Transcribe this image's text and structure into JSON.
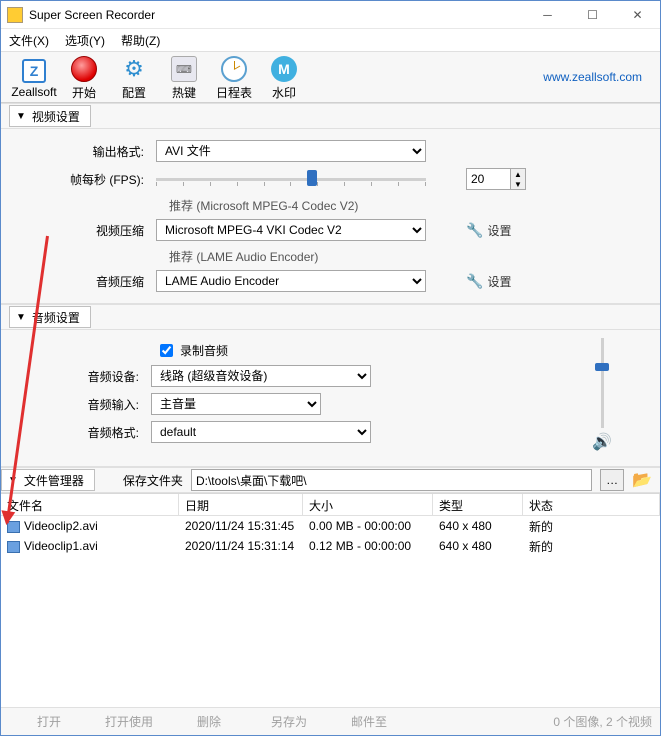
{
  "titlebar": {
    "title": "Super Screen Recorder"
  },
  "menus": {
    "file": "文件(X)",
    "options": "选项(Y)",
    "help": "帮助(Z)"
  },
  "toolbar": {
    "brand": "Zeallsoft",
    "start": "开始",
    "config": "配置",
    "hotkey": "热键",
    "schedule": "日程表",
    "watermark": "水印",
    "url": "www.zeallsoft.com"
  },
  "sections": {
    "video": "视频设置",
    "audio": "音频设置",
    "files": "文件管理器"
  },
  "video": {
    "output_label": "输出格式:",
    "output_value": "AVI 文件",
    "fps_label": "帧每秒 (FPS):",
    "fps_value": "20",
    "vcodec_rec": "推荐 (Microsoft MPEG-4 Codec V2)",
    "vcodec_label": "视频压缩",
    "vcodec_value": "Microsoft MPEG-4  VKI  Codec V2",
    "acodec_rec": "推荐 (LAME Audio Encoder)",
    "acodec_label": "音频压缩",
    "acodec_value": "LAME Audio Encoder",
    "settings": "设置"
  },
  "audio": {
    "record_label": "录制音频",
    "device_label": "音频设备:",
    "device_value": "线路 (超级音效设备)",
    "input_label": "音频输入:",
    "input_value": "主音量",
    "format_label": "音频格式:",
    "format_value": "default"
  },
  "filemgr": {
    "save_label": "保存文件夹",
    "save_path": "D:\\tools\\桌面\\下载吧\\"
  },
  "table": {
    "headers": {
      "name": "文件名",
      "date": "日期",
      "size": "大小",
      "type": "类型",
      "status": "状态"
    },
    "rows": [
      {
        "name": "Videoclip2.avi",
        "date": "2020/11/24 15:31:45",
        "size": "0.00 MB - 00:00:00",
        "type": "640 x 480",
        "status": "新的"
      },
      {
        "name": "Videoclip1.avi",
        "date": "2020/11/24 15:31:14",
        "size": "0.12 MB - 00:00:00",
        "type": "640 x 480",
        "status": "新的"
      }
    ]
  },
  "status": {
    "open": "打开",
    "open_with": "打开使用",
    "delete": "删除",
    "saveas": "另存为",
    "email": "邮件至",
    "summary": "0 个图像, 2 个视频"
  }
}
